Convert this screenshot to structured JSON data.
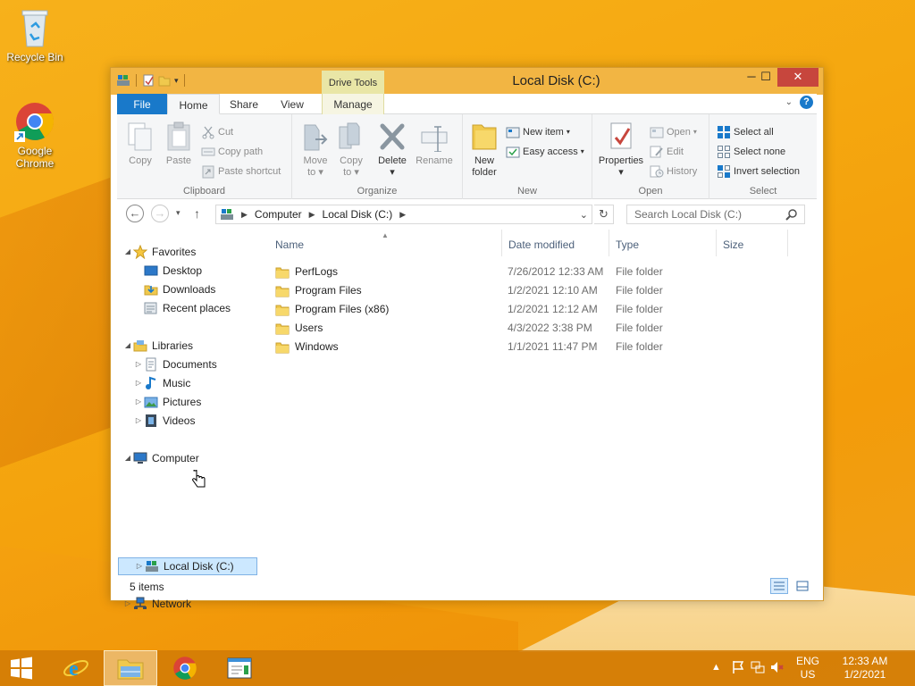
{
  "desktop": {
    "icons": [
      {
        "label": "Recycle Bin",
        "icon": "recycle-bin-icon"
      },
      {
        "label": "Google\nChrome",
        "label_line1": "Google",
        "label_line2": "Chrome",
        "icon": "chrome-icon"
      }
    ]
  },
  "window": {
    "title": "Local Disk (C:)",
    "contextual_tab_group": "Drive Tools",
    "tabs": {
      "file": "File",
      "home": "Home",
      "share": "Share",
      "view": "View",
      "manage": "Manage"
    },
    "ribbon": {
      "clipboard": {
        "label": "Clipboard",
        "copy": "Copy",
        "paste": "Paste",
        "cut": "Cut",
        "copy_path": "Copy path",
        "paste_shortcut": "Paste shortcut"
      },
      "organize": {
        "label": "Organize",
        "move_to": "Move",
        "move_to2": "to",
        "copy_to": "Copy",
        "copy_to2": "to",
        "delete": "Delete",
        "rename": "Rename"
      },
      "new": {
        "label": "New",
        "new_folder": "New",
        "new_folder2": "folder",
        "new_item": "New item",
        "easy_access": "Easy access"
      },
      "open": {
        "label": "Open",
        "properties": "Properties",
        "open": "Open",
        "edit": "Edit",
        "history": "History"
      },
      "select": {
        "label": "Select",
        "select_all": "Select all",
        "select_none": "Select none",
        "invert_selection": "Invert selection"
      }
    },
    "address": {
      "crumbs": [
        "Computer",
        "Local Disk (C:)"
      ],
      "search_placeholder": "Search Local Disk (C:)"
    },
    "nav": {
      "favorites": "Favorites",
      "desktop": "Desktop",
      "downloads": "Downloads",
      "recent_places": "Recent places",
      "libraries": "Libraries",
      "documents": "Documents",
      "music": "Music",
      "pictures": "Pictures",
      "videos": "Videos",
      "computer": "Computer",
      "local_disk": "Local Disk (C:)",
      "network": "Network"
    },
    "columns": {
      "name": "Name",
      "date_modified": "Date modified",
      "type": "Type",
      "size": "Size"
    },
    "files": [
      {
        "name": "PerfLogs",
        "date": "7/26/2012 12:33 AM",
        "type": "File folder"
      },
      {
        "name": "Program Files",
        "date": "1/2/2021 12:10 AM",
        "type": "File folder"
      },
      {
        "name": "Program Files (x86)",
        "date": "1/2/2021 12:12 AM",
        "type": "File folder"
      },
      {
        "name": "Users",
        "date": "4/3/2022 3:38 PM",
        "type": "File folder"
      },
      {
        "name": "Windows",
        "date": "1/1/2021 11:47 PM",
        "type": "File folder"
      }
    ],
    "status": "5 items"
  },
  "taskbar": {
    "items": [
      "start-icon",
      "internet-explorer-icon",
      "file-explorer-icon",
      "chrome-icon",
      "notepad-icon"
    ],
    "tray": {
      "lang1": "ENG",
      "lang2": "US",
      "time": "12:33 AM",
      "date": "1/2/2021"
    }
  },
  "colors": {
    "accent": "#1979ca",
    "title_bar": "#f2b543",
    "taskbar": "#d17b06"
  }
}
